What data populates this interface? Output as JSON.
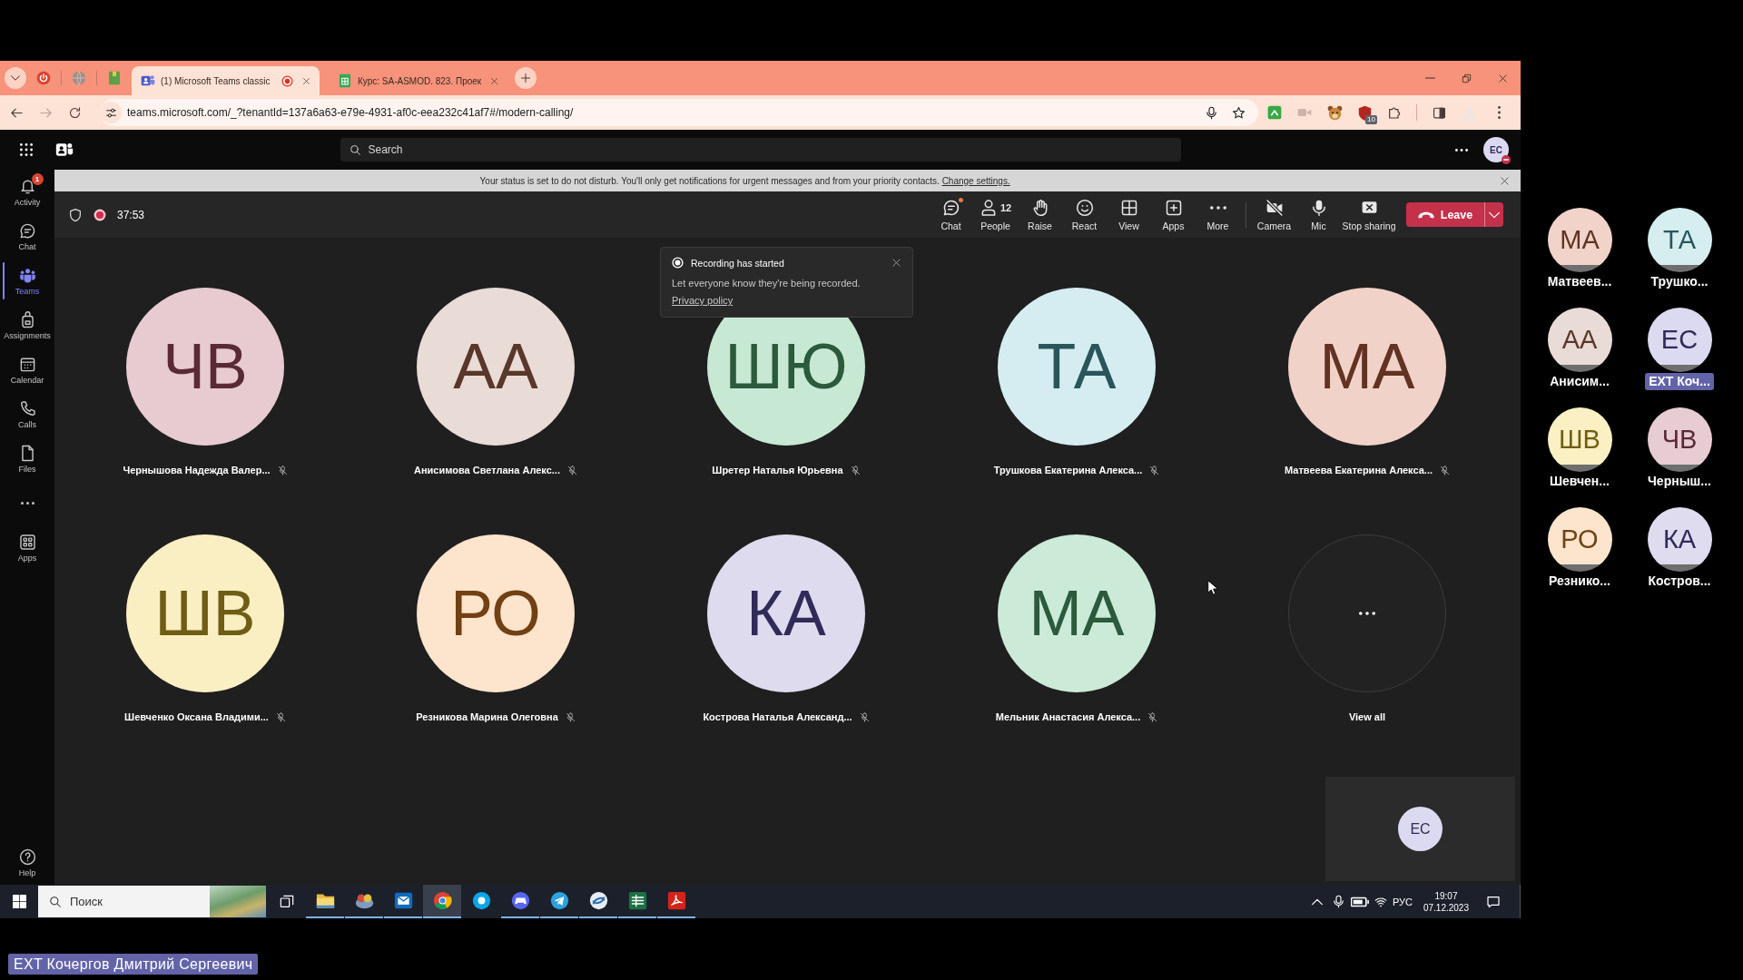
{
  "browser": {
    "tabs": [
      {
        "title": "(1) Microsoft Teams classic",
        "selected": true,
        "recording": true
      },
      {
        "title": "Курс: SA-ASMOD. 823. Проек",
        "selected": false,
        "recording": false
      }
    ],
    "address": "teams.microsoft.com/_?tenantId=137a6a63-e79e-4931-af0c-eea232c41af7#/modern-calling/",
    "extension_badge": "10"
  },
  "teams_header": {
    "search": {
      "placeholder": "Search"
    },
    "avatar": {
      "initials": "EC",
      "do_not_disturb": true
    }
  },
  "rail": {
    "items": [
      {
        "label": "Activity",
        "badge": "1",
        "selected": false
      },
      {
        "label": "Chat",
        "selected": false
      },
      {
        "label": "Teams",
        "selected": true
      },
      {
        "label": "Assignments",
        "selected": false
      },
      {
        "label": "Calendar",
        "selected": false
      },
      {
        "label": "Calls",
        "selected": false
      },
      {
        "label": "Files",
        "selected": false
      }
    ],
    "overflow_items": [
      {
        "label": "Apps",
        "selected": false
      }
    ],
    "help": "Help"
  },
  "banner": {
    "text": "Your status is set to do not disturb. You'll only get notifications for urgent messages and from your priority contacts.",
    "link": "Change settings."
  },
  "meeting": {
    "recording": true,
    "timer": "37:53",
    "toolbar": [
      {
        "label": "Chat",
        "unread": true
      },
      {
        "label": "People",
        "count": "12",
        "unread": false
      },
      {
        "label": "Raise",
        "unread": false
      },
      {
        "label": "React",
        "unread": false
      },
      {
        "label": "View",
        "unread": false
      },
      {
        "label": "Apps",
        "unread": false
      },
      {
        "label": "More",
        "unread": false
      }
    ],
    "device_controls": [
      {
        "label": "Camera",
        "on": false
      },
      {
        "label": "Mic",
        "on": true
      }
    ],
    "stop_sharing": "Stop sharing",
    "leave": "Leave"
  },
  "toast": {
    "title": "Recording has started",
    "text": "Let everyone know they're being recorded.",
    "link": "Privacy policy"
  },
  "stage": {
    "tiles": [
      {
        "initials": "ЧВ",
        "name": "Чернышова Надежда Валер...",
        "color": "#e7cbd1",
        "muted": true
      },
      {
        "initials": "АА",
        "name": "Анисимова Светлана Алекс...",
        "color": "#e9dbd6",
        "muted": true
      },
      {
        "initials": "ШЮ",
        "name": "Шретер Наталья Юрьевна",
        "color": "#c7e9d4",
        "muted": true
      },
      {
        "initials": "ТА",
        "name": "Трушкова Екатерина Алекса...",
        "color": "#d5edf0",
        "muted": true
      },
      {
        "initials": "МА",
        "name": "Матвеева Екатерина Алекса...",
        "color": "#f1d2c8",
        "muted": true
      },
      {
        "initials": "ШВ",
        "name": "Шевченко Оксана Владими...",
        "color": "#faefc3",
        "muted": true
      },
      {
        "initials": "РО",
        "name": "Резникова Марина Олеговна",
        "color": "#fde4cc",
        "muted": true
      },
      {
        "initials": "КА",
        "name": "Кострова Наталья Александ...",
        "color": "#dddbed",
        "muted": true
      },
      {
        "initials": "МА",
        "name": "Мельник Анастасия Алекса...",
        "color": "#cbead7",
        "muted": true
      }
    ],
    "view_all": "View all",
    "self_view": {
      "initials": "EC",
      "color": "#dcdaf0"
    }
  },
  "taskbar": {
    "search": {
      "placeholder": "Поиск"
    },
    "apps": [
      {
        "running": true,
        "selected": false
      },
      {
        "running": true,
        "selected": false
      },
      {
        "running": true,
        "selected": false
      },
      {
        "running": true,
        "selected": true
      },
      {
        "running": false,
        "selected": false
      },
      {
        "running": true,
        "selected": false
      },
      {
        "running": true,
        "selected": false
      },
      {
        "running": true,
        "selected": false
      },
      {
        "running": true,
        "selected": false
      },
      {
        "running": true,
        "selected": false
      }
    ],
    "language": "РУС",
    "time": "19:07",
    "date": "07.12.2023"
  },
  "gallery": {
    "participants": [
      {
        "initials": "МА",
        "name": "Матвеев...",
        "color": "#f1d3c9",
        "presenter": false
      },
      {
        "initials": "ТА",
        "name": "Трушко...",
        "color": "#d6eef0",
        "presenter": false
      },
      {
        "initials": "АА",
        "name": "Анисим...",
        "color": "#e9dbd6",
        "presenter": false
      },
      {
        "initials": "EC",
        "name": "EXT Коч...",
        "color": "#dcdaf0",
        "presenter": true
      },
      {
        "initials": "ШВ",
        "name": "Шевчен...",
        "color": "#fbf0c4",
        "presenter": false
      },
      {
        "initials": "ЧВ",
        "name": "Черныш...",
        "color": "#e8ccd3",
        "presenter": false
      },
      {
        "initials": "РО",
        "name": "Резнико...",
        "color": "#fde5cd",
        "presenter": false
      },
      {
        "initials": "КА",
        "name": "Костров...",
        "color": "#dedcee",
        "presenter": false
      }
    ]
  },
  "presenter_label": "EXT Кочергов Дмитрий Сергеевич"
}
